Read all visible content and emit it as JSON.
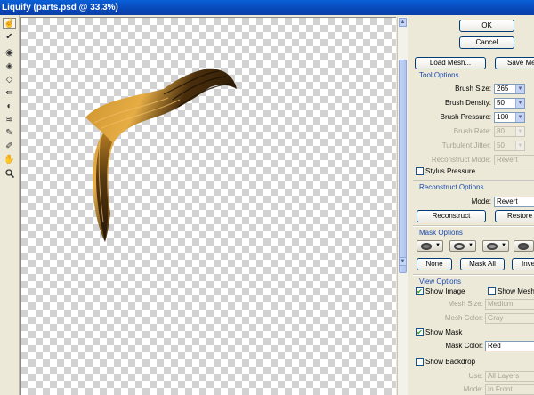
{
  "window": {
    "title": "Liquify (parts.psd @ 33.3%)"
  },
  "toolbox": {
    "tools": [
      {
        "name": "forward-warp-tool",
        "glyph": "☝"
      },
      {
        "name": "reconstruct-tool",
        "glyph": "✔"
      },
      {
        "name": "twirl-clockwise-tool",
        "glyph": "◉"
      },
      {
        "name": "pucker-tool",
        "glyph": "◈"
      },
      {
        "name": "bloat-tool",
        "glyph": "◇"
      },
      {
        "name": "push-left-tool",
        "glyph": "⇚"
      },
      {
        "name": "mirror-tool",
        "glyph": "◐"
      },
      {
        "name": "turbulence-tool",
        "glyph": "≋"
      },
      {
        "name": "freeze-mask-tool",
        "glyph": "✎"
      },
      {
        "name": "thaw-mask-tool",
        "glyph": "✐"
      },
      {
        "name": "hand-tool",
        "glyph": "✋"
      },
      {
        "name": "zoom-tool",
        "glyph": "🔍"
      }
    ]
  },
  "buttons": {
    "ok": "OK",
    "cancel": "Cancel",
    "load_mesh": "Load Mesh...",
    "save_mesh": "Save Mesh...",
    "reconstruct": "Reconstruct",
    "restore_all": "Restore All",
    "none": "None",
    "mask_all": "Mask All",
    "invert_all": "Invert All"
  },
  "tool_options": {
    "heading": "Tool Options",
    "brush_size_label": "Brush Size:",
    "brush_size": "265",
    "brush_density_label": "Brush Density:",
    "brush_density": "50",
    "brush_pressure_label": "Brush Pressure:",
    "brush_pressure": "100",
    "brush_rate_label": "Brush Rate:",
    "brush_rate": "80",
    "turbulent_jitter_label": "Turbulent Jitter:",
    "turbulent_jitter": "50",
    "reconstruct_mode_label": "Reconstruct Mode:",
    "reconstruct_mode": "Revert",
    "stylus_pressure_label": "Stylus Pressure",
    "stylus_pressure": false
  },
  "reconstruct_options": {
    "heading": "Reconstruct Options",
    "mode_label": "Mode:",
    "mode": "Revert"
  },
  "mask_options": {
    "heading": "Mask Options"
  },
  "view_options": {
    "heading": "View Options",
    "show_image_label": "Show Image",
    "show_image": true,
    "show_mesh_label": "Show Mesh",
    "show_mesh": false,
    "mesh_size_label": "Mesh Size:",
    "mesh_size": "Medium",
    "mesh_color_label": "Mesh Color:",
    "mesh_color": "Gray",
    "show_mask_label": "Show Mask",
    "show_mask": true,
    "mask_color_label": "Mask Color:",
    "mask_color": "Red",
    "show_backdrop_label": "Show Backdrop",
    "show_backdrop": false,
    "use_label": "Use:",
    "use": "All Layers",
    "mode_label": "Mode:",
    "mode": "In Front"
  },
  "colors": {
    "accent": "#1b49b0",
    "titlebar": "#0a5fd8",
    "hair_dark": "#2a1a06",
    "hair_light": "#e0a53a"
  }
}
